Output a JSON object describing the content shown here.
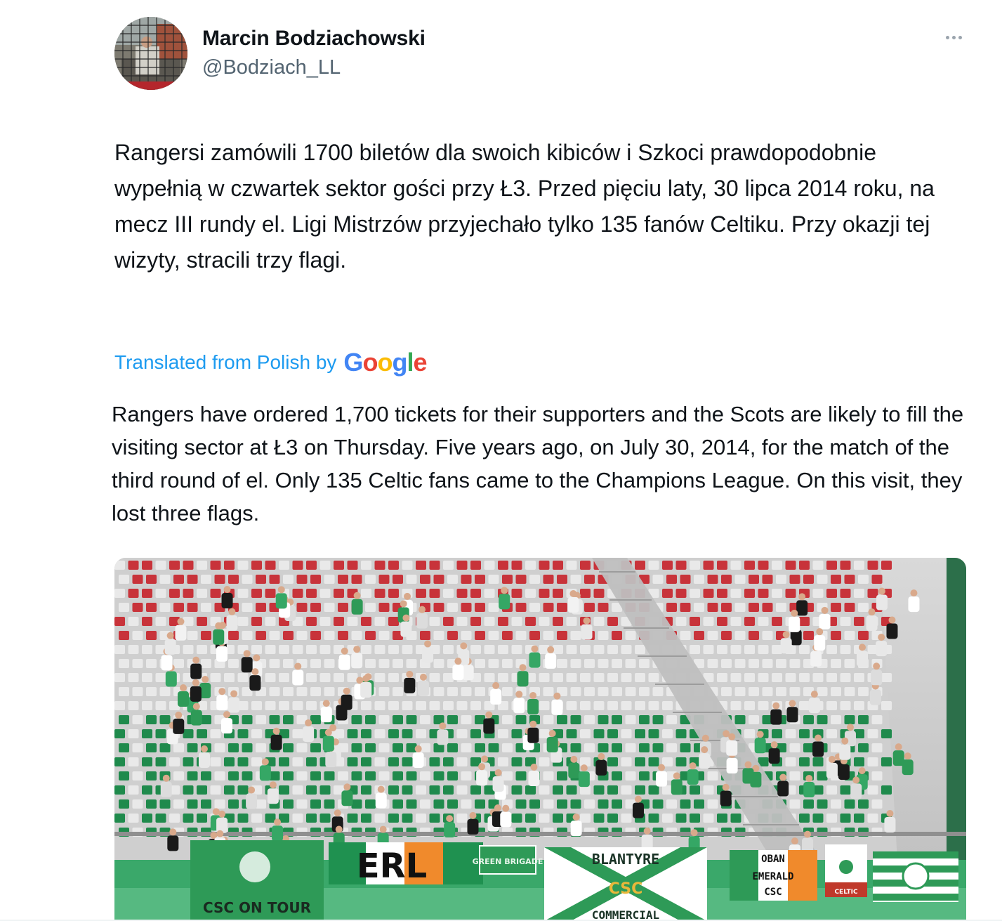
{
  "author": {
    "display_name": "Marcin Bodziachowski",
    "handle": "@Bodziach_LL",
    "avatar_icon": "avatar-photo"
  },
  "menu": {
    "icon": "more-dots-icon"
  },
  "tweet": {
    "original_text": "Rangersi zamówili 1700 biletów dla swoich kibiców i Szkoci prawdopodobnie wypełnią w czwartek sektor gości przy Ł3. Przed pięciu laty, 30 lipca 2014 roku, na mecz III rundy el. Ligi Mistrzów przyjechało tylko 135 fanów Celtiku. Przy okazji tej wizyty, stracili trzy flagi.",
    "translation_label": "Translated from Polish by",
    "translation_provider": "Google",
    "translated_text": "Rangers have ordered 1,700 tickets for their supporters and the Scots are likely to fill the visiting sector at Ł3 on Thursday. Five years ago, on July 30, 2014, for the match of the third round of el. Only 135 Celtic fans came to the Champions League. On this visit, they lost three flags."
  },
  "media": {
    "banners": [
      "CSC ON TOUR",
      "ERL",
      "GREEN BRIGADE",
      "BLANTYRE",
      "CSC",
      "COMMERCIAL",
      "OBAN",
      "EMERALD",
      "CSC",
      "CELTIC"
    ]
  },
  "colors": {
    "link": "#1d9bf0",
    "secondary_text": "#536471",
    "seat_red": "#c8333a",
    "seat_green": "#1f8a4c",
    "seat_white": "#e9e9e9"
  }
}
